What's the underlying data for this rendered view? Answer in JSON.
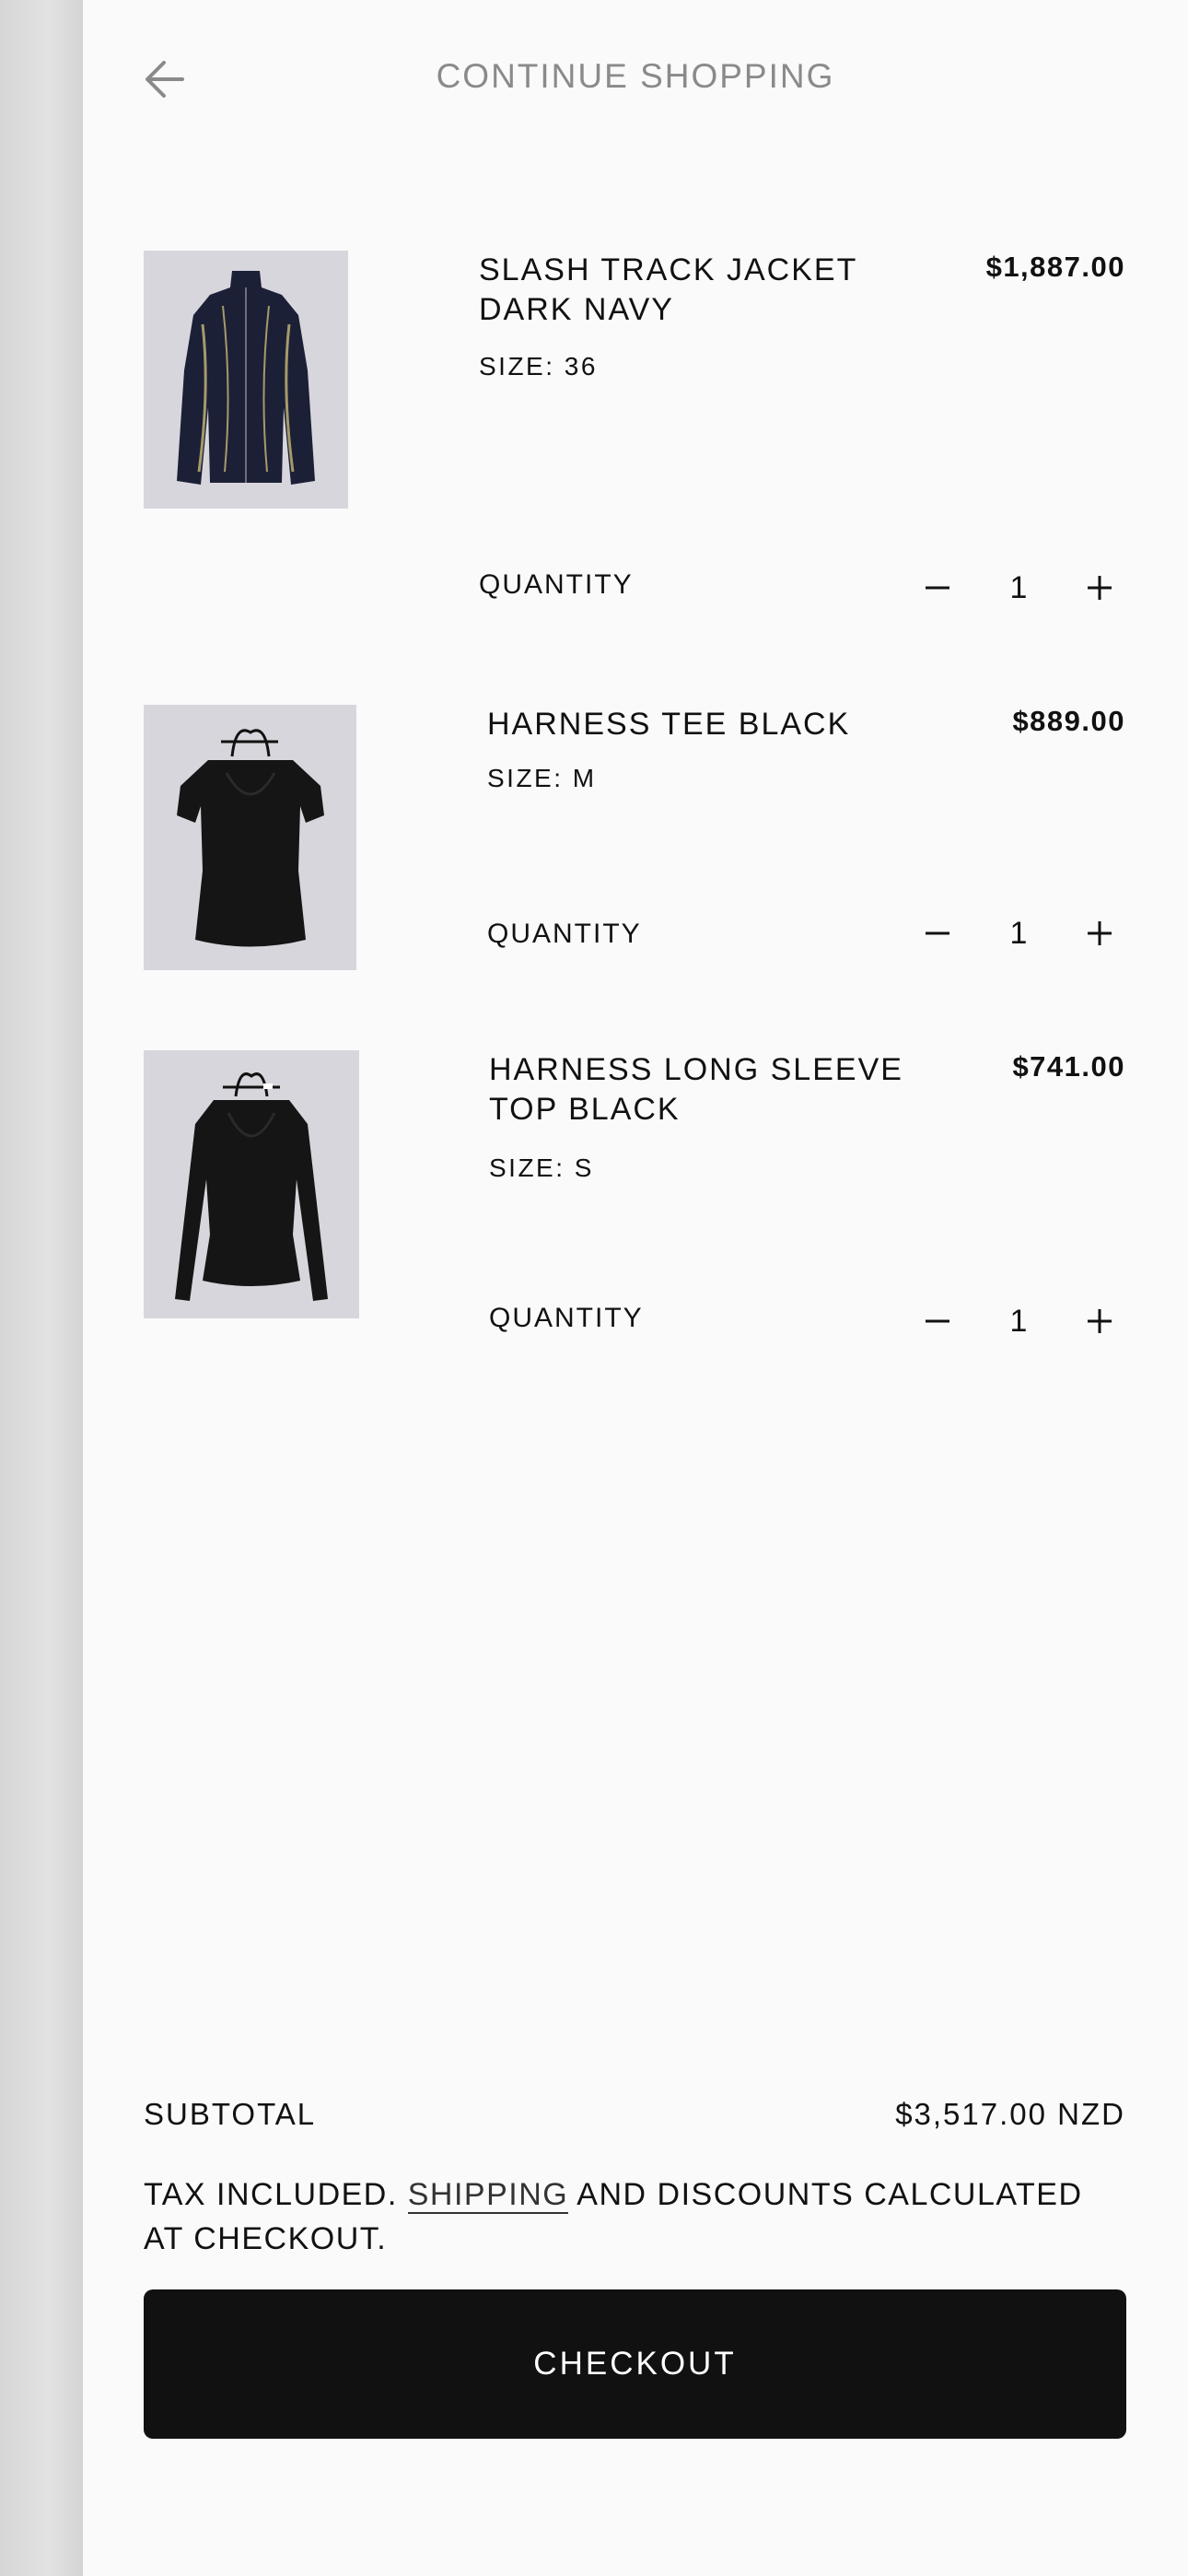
{
  "header": {
    "title": "CONTINUE SHOPPING",
    "back_icon": "arrow-left-icon"
  },
  "cart": {
    "items": [
      {
        "title": "SLASH TRACK JACKET DARK NAVY",
        "size": "SIZE: 36",
        "price": "$1,887.00",
        "quantity_label": "QUANTITY",
        "quantity": "1"
      },
      {
        "title": "HARNESS TEE BLACK",
        "size": "SIZE: M",
        "price": "$889.00",
        "quantity_label": "QUANTITY",
        "quantity": "1"
      },
      {
        "title": "HARNESS LONG SLEEVE TOP BLACK",
        "size": "SIZE: S",
        "price": "$741.00",
        "quantity_label": "QUANTITY",
        "quantity": "1"
      }
    ]
  },
  "summary": {
    "subtotal_label": "SUBTOTAL",
    "subtotal_value": "$3,517.00 NZD",
    "tax_prefix": "TAX INCLUDED. ",
    "shipping_link": "SHIPPING",
    "tax_suffix": " AND DISCOUNTS CALCULATED AT CHECKOUT."
  },
  "checkout": {
    "label": "CHECKOUT"
  },
  "colors": {
    "panel_bg": "#fafafa",
    "button_bg": "#111111",
    "muted_text": "#8a8a8a",
    "thumb_bg": "#d6d6da"
  }
}
